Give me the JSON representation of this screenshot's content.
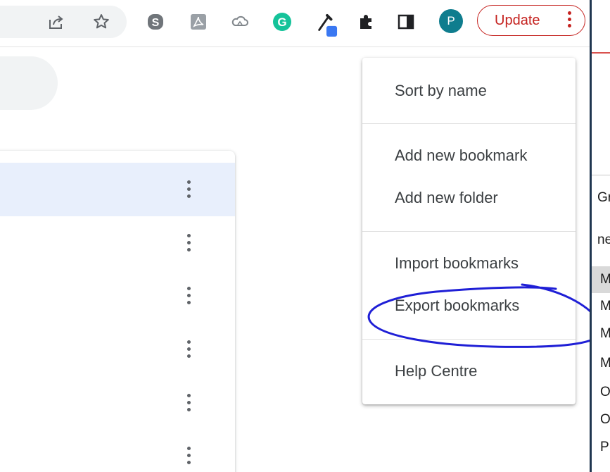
{
  "toolbar": {
    "icons": [
      "share-icon",
      "bookmark-star-icon",
      "skype-icon",
      "acrobat-icon",
      "cloud-icon",
      "grammarly-icon",
      "eyedropper-icon",
      "extensions-puzzle-icon",
      "side-panel-icon"
    ],
    "profile_initial": "P",
    "update_label": "Update"
  },
  "menu": {
    "items": [
      {
        "label": "Sort by name"
      },
      {
        "label": "Add new bookmark"
      },
      {
        "label": "Add new folder"
      },
      {
        "label": "Import bookmarks"
      },
      {
        "label": "Export bookmarks"
      },
      {
        "label": "Help Centre"
      }
    ]
  },
  "background_app": {
    "fragments": [
      "Gr",
      "ne",
      "M",
      "M",
      "M",
      "M",
      "O",
      "O",
      "P"
    ]
  },
  "colors": {
    "desktop": "#1f3650",
    "update_red": "#c5221f",
    "selected_row": "#e8effc",
    "annotation": "#1f1fd6",
    "avatar": "#0f7d8e",
    "grammarly": "#15c39a",
    "eyedropper_swatch": "#3a78f2"
  }
}
